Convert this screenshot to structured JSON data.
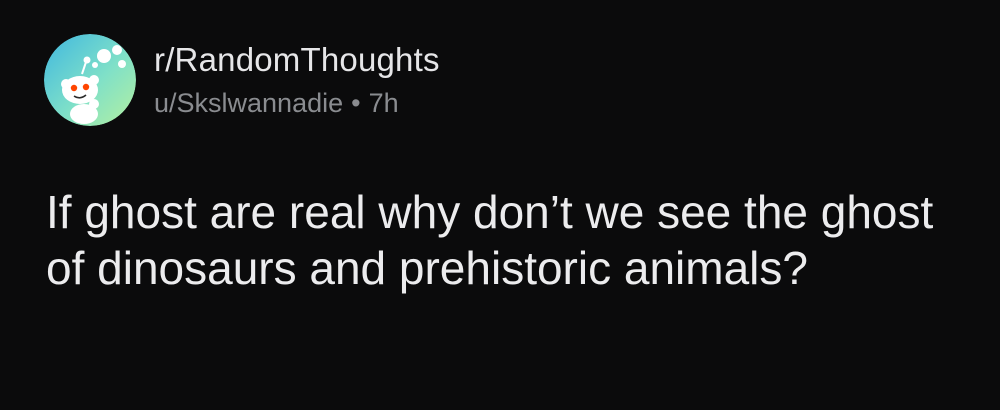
{
  "post": {
    "subreddit": "r/RandomThoughts",
    "author": "u/Skslwannadie",
    "separator": "•",
    "age": "7h",
    "title": "If ghost are real why don’t we see the ghost of dinosaurs and prehistoric animals?"
  },
  "avatar": {
    "icon": "reddit-snoo-thinking-icon",
    "colors": {
      "background_gradient": [
        "#3fb7e0",
        "#7fe0c8",
        "#b5f0a0"
      ],
      "face": "#ffffff",
      "eyes": "#ff4500"
    }
  },
  "theme": {
    "background": "#0b0b0c",
    "primary_text": "#e6e6e8",
    "secondary_text": "#8a8c90"
  }
}
